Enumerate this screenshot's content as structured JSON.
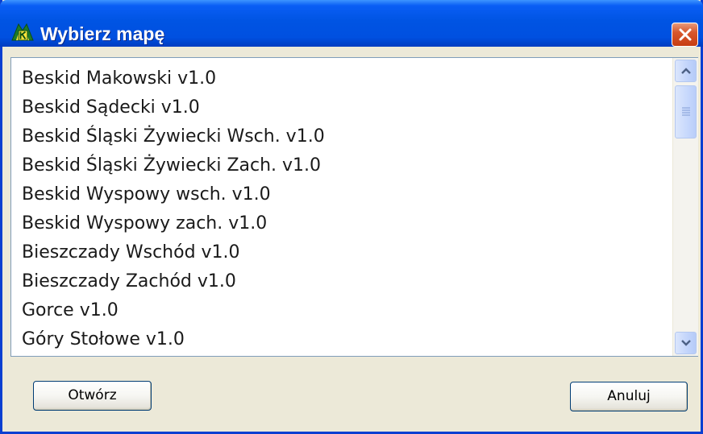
{
  "window": {
    "title": "Wybierz mapę",
    "colors": {
      "titlebar": "#0054e3",
      "close": "#d8572c",
      "face": "#ece9d8"
    }
  },
  "list": {
    "items": [
      "Beskid Makowski v1.0",
      "Beskid Sądecki v1.0",
      "Beskid Śląski Żywiecki Wsch. v1.0",
      "Beskid Śląski Żywiecki Zach. v1.0",
      "Beskid Wyspowy wsch. v1.0",
      "Beskid Wyspowy zach. v1.0",
      "Bieszczady Wschód v1.0",
      "Bieszczady Zachód v1.0",
      "Gorce v1.0",
      "Góry Stołowe v1.0"
    ]
  },
  "buttons": {
    "open_label": "Otwórz",
    "cancel_label": "Anuluj"
  },
  "icons": {
    "app": "mountain-k-icon",
    "close": "close-icon",
    "scroll_up": "chevron-up-icon",
    "scroll_down": "chevron-down-icon",
    "thumb_grip": "grip-icon"
  }
}
